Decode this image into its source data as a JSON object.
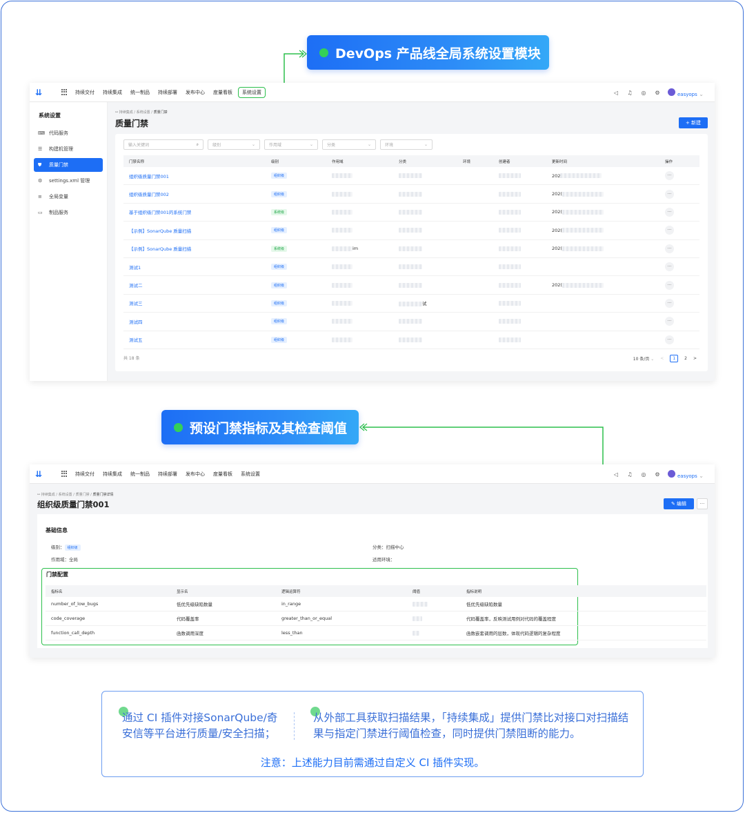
{
  "callouts": {
    "top": "DevOps 产品线全局系统设置模块",
    "middle": "预设门禁指标及其检查阈值"
  },
  "topbar": {
    "logo": "⇊",
    "nav": [
      "持续交付",
      "持续集成",
      "统一制品",
      "持续部署",
      "发布中心",
      "度量看板",
      "系统设置"
    ],
    "user": "easyops"
  },
  "sidebar": {
    "title": "系统设置",
    "items": [
      {
        "label": "代码服务",
        "icon": "code-icon",
        "glyph": "⌨"
      },
      {
        "label": "构建机管理",
        "icon": "server-icon",
        "glyph": "☰"
      },
      {
        "label": "质量门禁",
        "icon": "shield-icon",
        "glyph": "⛊"
      },
      {
        "label": "settings.xml 管理",
        "icon": "gear-icon",
        "glyph": "⚙"
      },
      {
        "label": "全局变量",
        "icon": "sliders-icon",
        "glyph": "≡"
      },
      {
        "label": "制品服务",
        "icon": "box-icon",
        "glyph": "▭"
      }
    ]
  },
  "list_page": {
    "breadcrumb": [
      "持续集成",
      "系统设置",
      "质量门禁"
    ],
    "title": "质量门禁",
    "new_button": "+ 新建",
    "filters": {
      "keyword_placeholder": "输入关键词",
      "level": "级别",
      "scope": "作用域",
      "category": "分类",
      "env": "环境"
    },
    "columns": [
      "门禁名称",
      "级别",
      "作用域",
      "分类",
      "环境",
      "创建者",
      "更新时间",
      "操作"
    ],
    "rows": [
      {
        "name": "组织级质量门禁001",
        "level": "组织级",
        "level_type": "blue",
        "scope_suffix": "",
        "category_suffix": "",
        "time_prefix": "202"
      },
      {
        "name": "组织级质量门禁002",
        "level": "组织级",
        "level_type": "blue",
        "scope_suffix": "",
        "category_suffix": "",
        "time_prefix": "202("
      },
      {
        "name": "基于组织级门禁001的系统门禁",
        "level": "系统级",
        "level_type": "green",
        "scope_suffix": "",
        "category_suffix": "",
        "time_prefix": "202("
      },
      {
        "name": "【示例】SonarQube 质量扫描",
        "level": "组织级",
        "level_type": "blue",
        "scope_suffix": "",
        "category_suffix": "",
        "time_prefix": "202("
      },
      {
        "name": "【示例】SonarQube 质量扫描",
        "level": "系统级",
        "level_type": "green",
        "scope_suffix": "im",
        "category_suffix": "",
        "time_prefix": "202("
      },
      {
        "name": "测试1",
        "level": "组织级",
        "level_type": "blue",
        "scope_suffix": "",
        "category_suffix": "",
        "time_prefix": ""
      },
      {
        "name": "测试二",
        "level": "组织级",
        "level_type": "blue",
        "scope_suffix": "",
        "category_suffix": "",
        "time_prefix": "202("
      },
      {
        "name": "测试三",
        "level": "组织级",
        "level_type": "blue",
        "scope_suffix": "",
        "category_suffix": "试",
        "time_prefix": ""
      },
      {
        "name": "测试四",
        "level": "组织级",
        "level_type": "blue",
        "scope_suffix": "",
        "category_suffix": "",
        "time_prefix": ""
      },
      {
        "name": "测试五",
        "level": "组织级",
        "level_type": "blue",
        "scope_suffix": "",
        "category_suffix": "",
        "time_prefix": ""
      }
    ],
    "more_glyph": "···",
    "total": "共 18 条",
    "page_size": "10 条/页",
    "pages": [
      "1",
      "2"
    ],
    "prev": "<",
    "next": ">"
  },
  "detail_page": {
    "breadcrumb": [
      "持续集成",
      "系统设置",
      "质量门禁",
      "质量门禁详情"
    ],
    "title": "组织级质量门禁001",
    "edit_button": "✎ 编辑",
    "more": "···",
    "basic_title": "基础信息",
    "level_label": "级别：",
    "level_value": "组织级",
    "scope_line": "作用域：全局",
    "category_line": "分类：扫描中心",
    "env_line": "适用环境：",
    "gate_title": "门禁配置",
    "columns": [
      "指标名",
      "显示名",
      "逻辑运算符",
      "阈值",
      "指标说明"
    ],
    "rows": [
      {
        "metric": "number_of_low_bugs",
        "display": "低优先级缺陷数量",
        "op": "in_range",
        "desc": "低优先级缺陷数量"
      },
      {
        "metric": "code_coverage",
        "display": "代码覆盖率",
        "op": "greater_than_or_equal",
        "desc": "代码覆盖率，反映测试用例对代码的覆盖程度"
      },
      {
        "metric": "function_call_depth",
        "display": "函数调用深度",
        "op": "less_than",
        "desc": "函数嵌套调用的层数，体现代码逻辑的复杂程度"
      }
    ]
  },
  "note": {
    "left": "通过 CI 插件对接SonarQube/奇安信等平台进行质量/安全扫描；",
    "right": "从外部工具获取扫描结果，「持续集成」提供门禁比对接口对扫描结果与指定门禁进行阈值检查，同时提供门禁阻断的能力。",
    "warning": "注意：上述能力目前需通过自定义 CI 插件实现。"
  },
  "colors": {
    "accent": "#1d6ef5",
    "highlight": "#2bbf4b"
  }
}
